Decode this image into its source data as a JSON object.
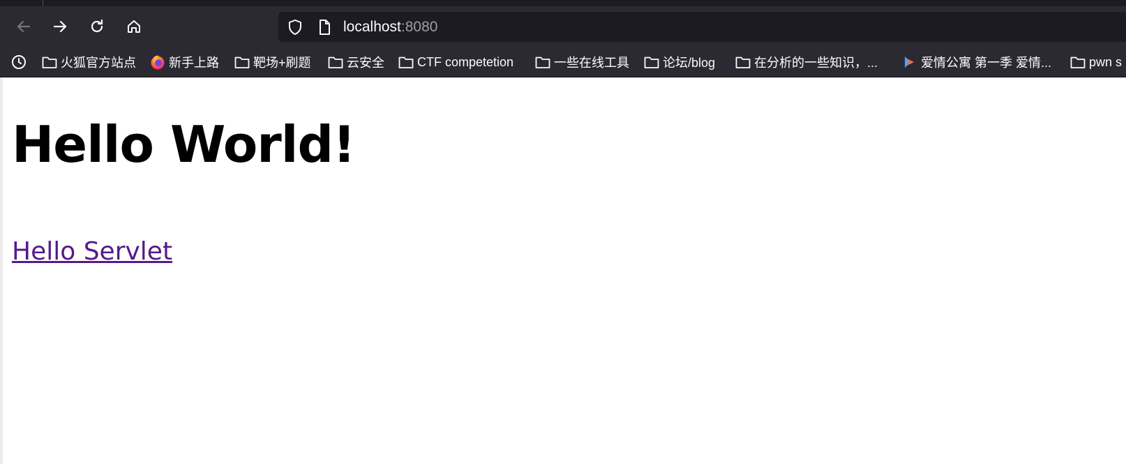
{
  "browser": {
    "url": {
      "host": "localhost",
      "port": ":8080"
    },
    "nav_icons": [
      "back-arrow-icon",
      "forward-arrow-icon",
      "reload-icon",
      "home-icon"
    ],
    "bookmarks": [
      {
        "label": "",
        "icon": "history-clock-icon"
      },
      {
        "label": "火狐官方站点",
        "icon": "folder-icon"
      },
      {
        "label": "新手上路",
        "icon": "firefox-logo-icon"
      },
      {
        "label": "靶场+刷题",
        "icon": "folder-icon"
      },
      {
        "label": "云安全",
        "icon": "folder-icon"
      },
      {
        "label": "CTF competetion",
        "icon": "folder-icon"
      },
      {
        "label": "一些在线工具",
        "icon": "folder-icon"
      },
      {
        "label": "论坛/blog",
        "icon": "folder-icon"
      },
      {
        "label": "在分析的一些知识，...",
        "icon": "folder-icon"
      },
      {
        "label": "爱情公寓 第一季 爱情...",
        "icon": "video-play-icon"
      },
      {
        "label": "pwn s",
        "icon": "folder-icon"
      }
    ],
    "colors": {
      "toolbar": "#2b2a33",
      "urlbar": "#1c1b22",
      "visited_link": "#551a8b"
    }
  },
  "page": {
    "heading": "Hello World!",
    "link": "Hello Servlet"
  }
}
